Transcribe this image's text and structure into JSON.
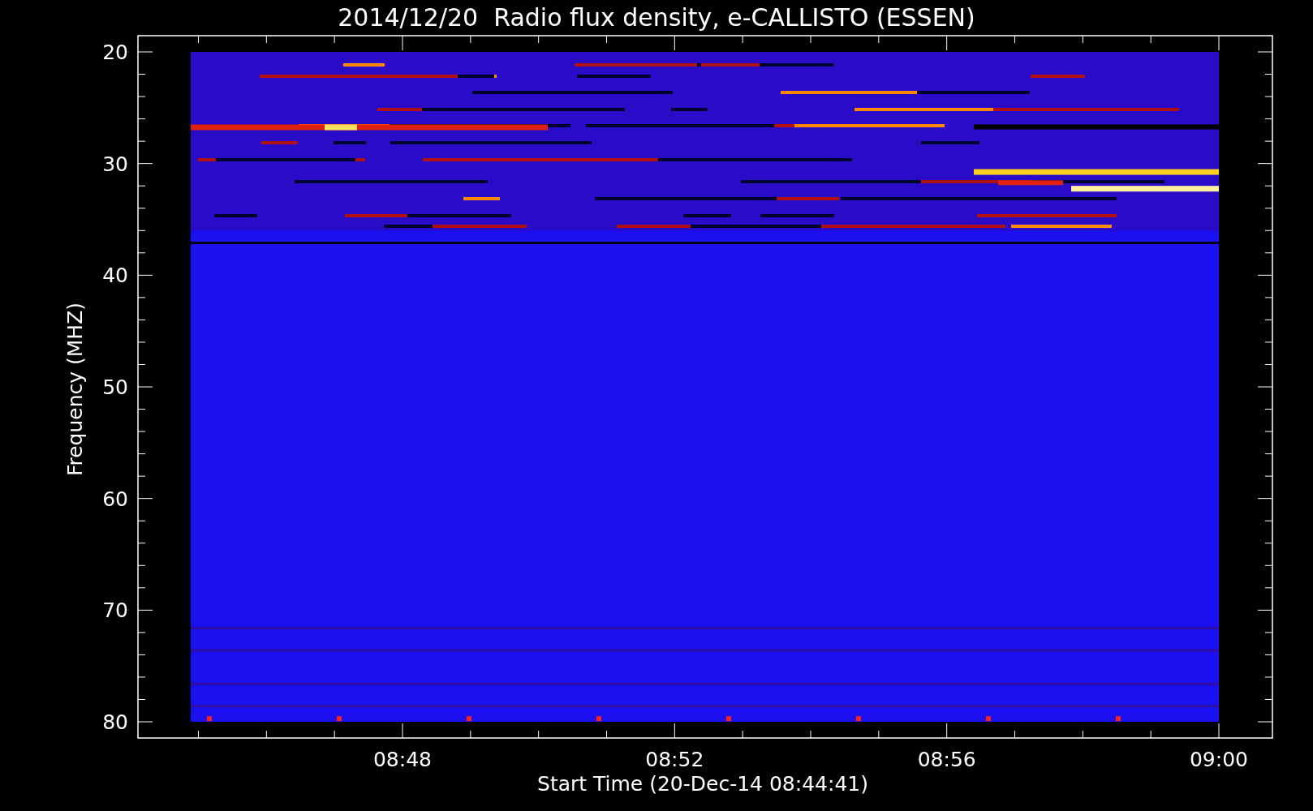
{
  "title": "2014/12/20  Radio flux density, e-CALLISTO (ESSEN)",
  "ylabel": "Frequency (MHZ)",
  "xlabel": "Start Time (20-Dec-14 08:44:41)",
  "yticks": [
    "20",
    "30",
    "40",
    "50",
    "60",
    "70",
    "80"
  ],
  "xticks": [
    "08:48",
    "08:52",
    "08:56",
    "09:00"
  ]
}
